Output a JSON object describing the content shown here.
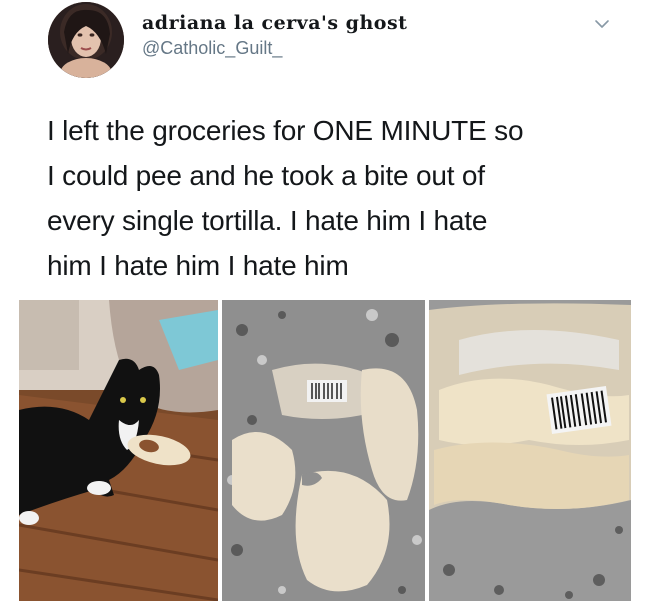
{
  "tweet": {
    "author": {
      "display_name": "adriana la cerva's ghost",
      "handle": "@Catholic_Guilt_"
    },
    "text_lines": [
      "I left the groceries for ONE MINUTE so",
      "I could pee and he took a bite out of",
      "every single tortilla. I hate him I hate",
      "him I hate him I hate him"
    ],
    "menu_icon": "chevron-down-icon",
    "media": [
      {
        "subject": "cat-with-tortilla-photo"
      },
      {
        "subject": "bitten-tortillas-on-counter-photo"
      },
      {
        "subject": "tortilla-package-photo"
      }
    ]
  },
  "colors": {
    "text": "#14171a",
    "secondary_text": "#657786",
    "background": "#ffffff"
  }
}
